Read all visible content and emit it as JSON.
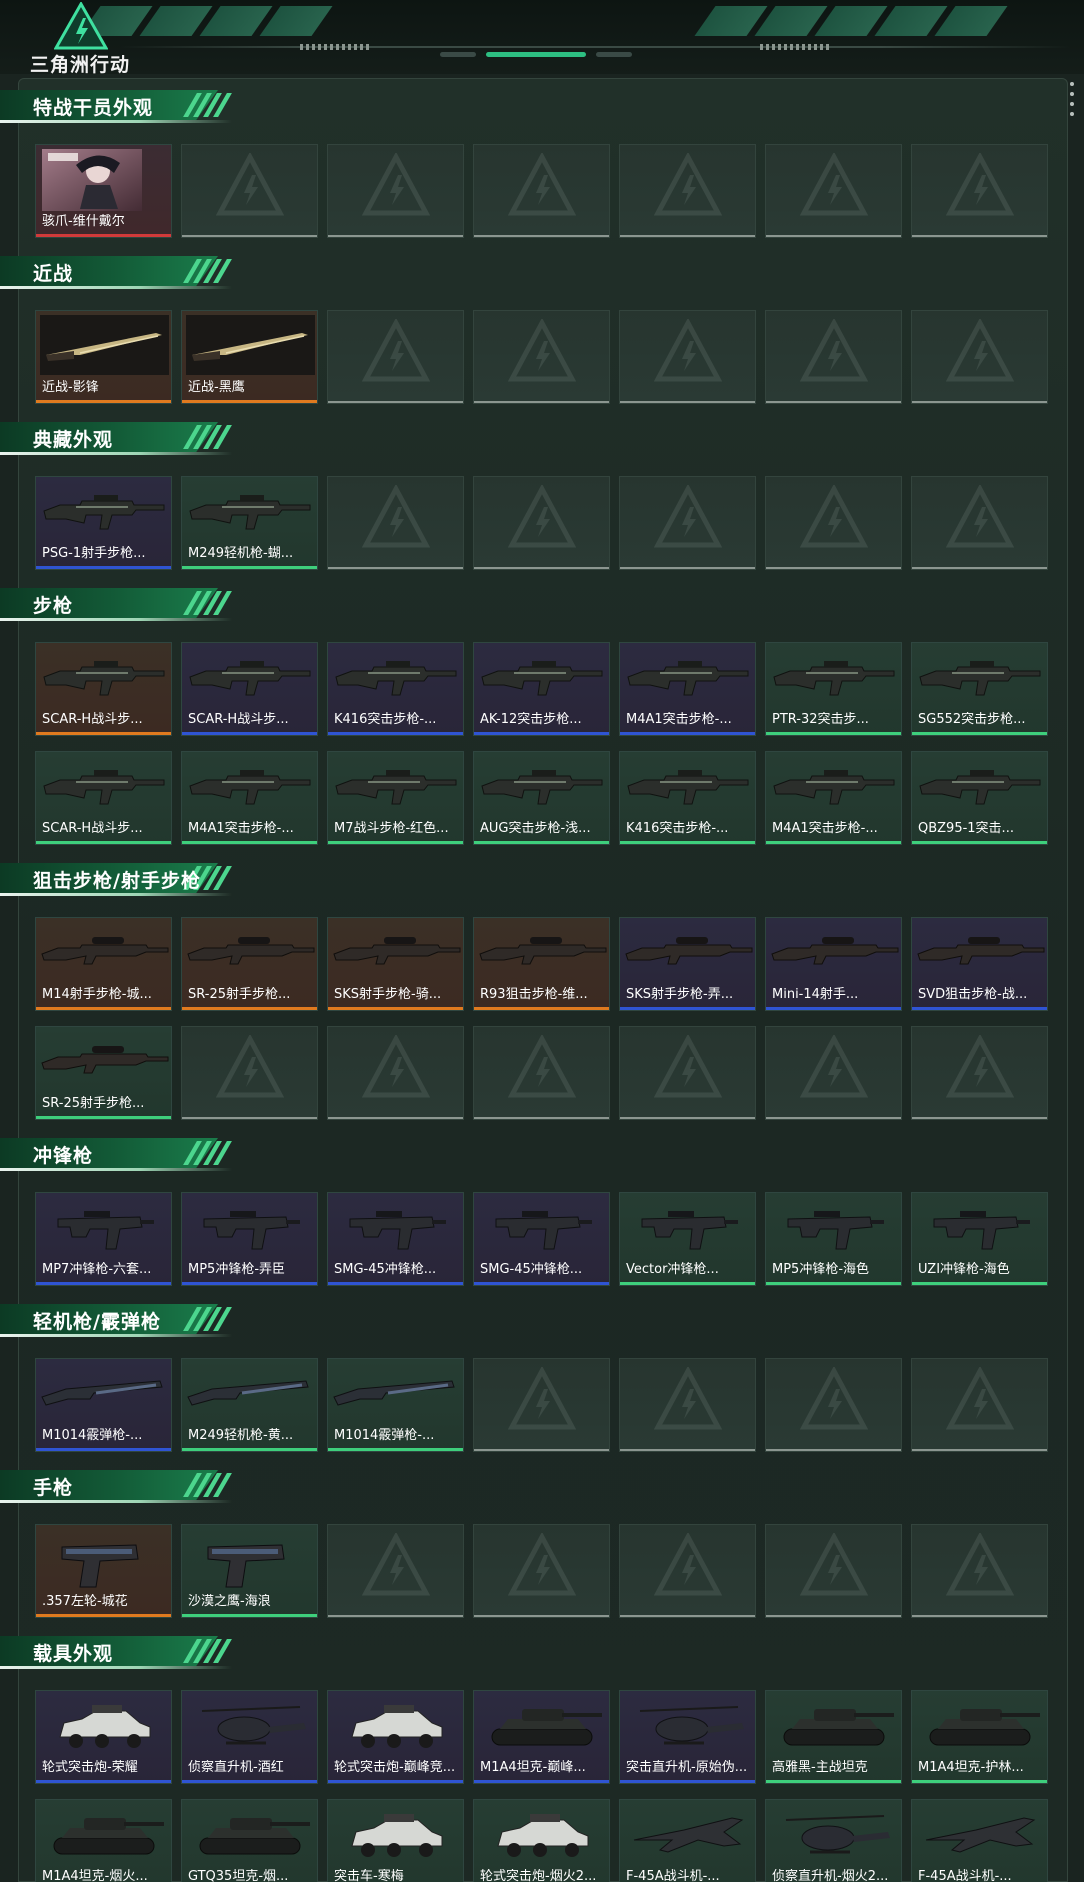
{
  "app": {
    "logo_text": "三角洲行动"
  },
  "colors": {
    "accent": "#2dbf82",
    "rarity_red": "#d23a3a",
    "rarity_orange": "#e07a1f",
    "rarity_purple": "#2f54d3",
    "rarity_blue": "#3a7bd5",
    "rarity_green": "#3ecf7c"
  },
  "sections": [
    {
      "title": "特战干员外观",
      "items": [
        {
          "name": "骇爪-维什戴尔",
          "rarity": "red",
          "icon": "operator-portrait"
        }
      ]
    },
    {
      "title": "近战",
      "items": [
        {
          "name": "近战-影锋",
          "rarity": "orange",
          "icon": "melee-blade"
        },
        {
          "name": "近战-黑鹰",
          "rarity": "orange",
          "icon": "melee-blade"
        }
      ]
    },
    {
      "title": "典藏外观",
      "items": [
        {
          "name": "PSG-1射手步枪...",
          "rarity": "purple",
          "icon": "rifle"
        },
        {
          "name": "M249轻机枪-蝴...",
          "rarity": "green",
          "icon": "rifle"
        }
      ]
    },
    {
      "title": "步枪",
      "items": [
        {
          "name": "SCAR-H战斗步...",
          "rarity": "orange",
          "icon": "rifle"
        },
        {
          "name": "SCAR-H战斗步...",
          "rarity": "purple",
          "icon": "rifle"
        },
        {
          "name": "K416突击步枪-...",
          "rarity": "purple",
          "icon": "rifle"
        },
        {
          "name": "AK-12突击步枪...",
          "rarity": "purple",
          "icon": "rifle"
        },
        {
          "name": "M4A1突击步枪-...",
          "rarity": "purple",
          "icon": "rifle"
        },
        {
          "name": "PTR-32突击步...",
          "rarity": "green",
          "icon": "rifle"
        },
        {
          "name": "SG552突击步枪...",
          "rarity": "green",
          "icon": "rifle"
        },
        {
          "name": "SCAR-H战斗步...",
          "rarity": "green",
          "icon": "rifle"
        },
        {
          "name": "M4A1突击步枪-...",
          "rarity": "green",
          "icon": "rifle"
        },
        {
          "name": "M7战斗步枪-红色...",
          "rarity": "green",
          "icon": "rifle"
        },
        {
          "name": "AUG突击步枪-浅...",
          "rarity": "green",
          "icon": "rifle"
        },
        {
          "name": "K416突击步枪-...",
          "rarity": "green",
          "icon": "rifle"
        },
        {
          "name": "M4A1突击步枪-...",
          "rarity": "green",
          "icon": "rifle"
        },
        {
          "name": "QBZ95-1突击...",
          "rarity": "green",
          "icon": "rifle"
        }
      ]
    },
    {
      "title": "狙击步枪/射手步枪",
      "items": [
        {
          "name": "M14射手步枪-城...",
          "rarity": "orange",
          "icon": "sniper"
        },
        {
          "name": "SR-25射手步枪...",
          "rarity": "orange",
          "icon": "sniper"
        },
        {
          "name": "SKS射手步枪-骑...",
          "rarity": "orange",
          "icon": "sniper"
        },
        {
          "name": "R93狙击步枪-维...",
          "rarity": "orange",
          "icon": "sniper"
        },
        {
          "name": "SKS射手步枪-弄...",
          "rarity": "purple",
          "icon": "sniper"
        },
        {
          "name": "Mini-14射手...",
          "rarity": "purple",
          "icon": "sniper"
        },
        {
          "name": "SVD狙击步枪-战...",
          "rarity": "purple",
          "icon": "sniper"
        },
        {
          "name": "SR-25射手步枪...",
          "rarity": "green",
          "icon": "sniper"
        }
      ]
    },
    {
      "title": "冲锋枪",
      "items": [
        {
          "name": "MP7冲锋枪-六套...",
          "rarity": "purple",
          "icon": "smg"
        },
        {
          "name": "MP5冲锋枪-弄臣",
          "rarity": "purple",
          "icon": "smg"
        },
        {
          "name": "SMG-45冲锋枪...",
          "rarity": "purple",
          "icon": "smg"
        },
        {
          "name": "SMG-45冲锋枪...",
          "rarity": "purple",
          "icon": "smg"
        },
        {
          "name": "Vector冲锋枪...",
          "rarity": "green",
          "icon": "smg"
        },
        {
          "name": "MP5冲锋枪-海色",
          "rarity": "green",
          "icon": "smg"
        },
        {
          "name": "UZI冲锋枪-海色",
          "rarity": "green",
          "icon": "smg"
        }
      ]
    },
    {
      "title": "轻机枪/霰弹枪",
      "items": [
        {
          "name": "M1014霰弹枪-...",
          "rarity": "purple",
          "icon": "shotgun"
        },
        {
          "name": "M249轻机枪-黄...",
          "rarity": "green",
          "icon": "shotgun"
        },
        {
          "name": "M1014霰弹枪-...",
          "rarity": "green",
          "icon": "shotgun"
        }
      ]
    },
    {
      "title": "手枪",
      "items": [
        {
          "name": ".357左轮-城花",
          "rarity": "orange",
          "icon": "pistol"
        },
        {
          "name": "沙漠之鹰-海浪",
          "rarity": "green",
          "icon": "pistol"
        }
      ]
    },
    {
      "title": "载具外观",
      "items": [
        {
          "name": "轮式突击炮-荣耀",
          "rarity": "purple",
          "icon": "vehicle"
        },
        {
          "name": "侦察直升机-酒红",
          "rarity": "purple",
          "icon": "helicopter"
        },
        {
          "name": "轮式突击炮-巅峰竞...",
          "rarity": "purple",
          "icon": "vehicle"
        },
        {
          "name": "M1A4坦克-巅峰...",
          "rarity": "purple",
          "icon": "tank"
        },
        {
          "name": "突击直升机-原始伪...",
          "rarity": "purple",
          "icon": "helicopter"
        },
        {
          "name": "高雅黑-主战坦克",
          "rarity": "green",
          "icon": "tank"
        },
        {
          "name": "M1A4坦克-护林...",
          "rarity": "green",
          "icon": "tank"
        },
        {
          "name": "M1A4坦克-烟火...",
          "rarity": "green",
          "icon": "tank"
        },
        {
          "name": "GTQ35坦克-烟...",
          "rarity": "green",
          "icon": "tank"
        },
        {
          "name": "突击车-寒梅",
          "rarity": "green",
          "icon": "vehicle"
        },
        {
          "name": "轮式突击炮-烟火2...",
          "rarity": "green",
          "icon": "vehicle"
        },
        {
          "name": "F-45A战斗机-...",
          "rarity": "green",
          "icon": "jet"
        },
        {
          "name": "侦察直升机-烟火2...",
          "rarity": "green",
          "icon": "helicopter"
        },
        {
          "name": "F-45A战斗机-...",
          "rarity": "green",
          "icon": "jet"
        }
      ]
    }
  ]
}
